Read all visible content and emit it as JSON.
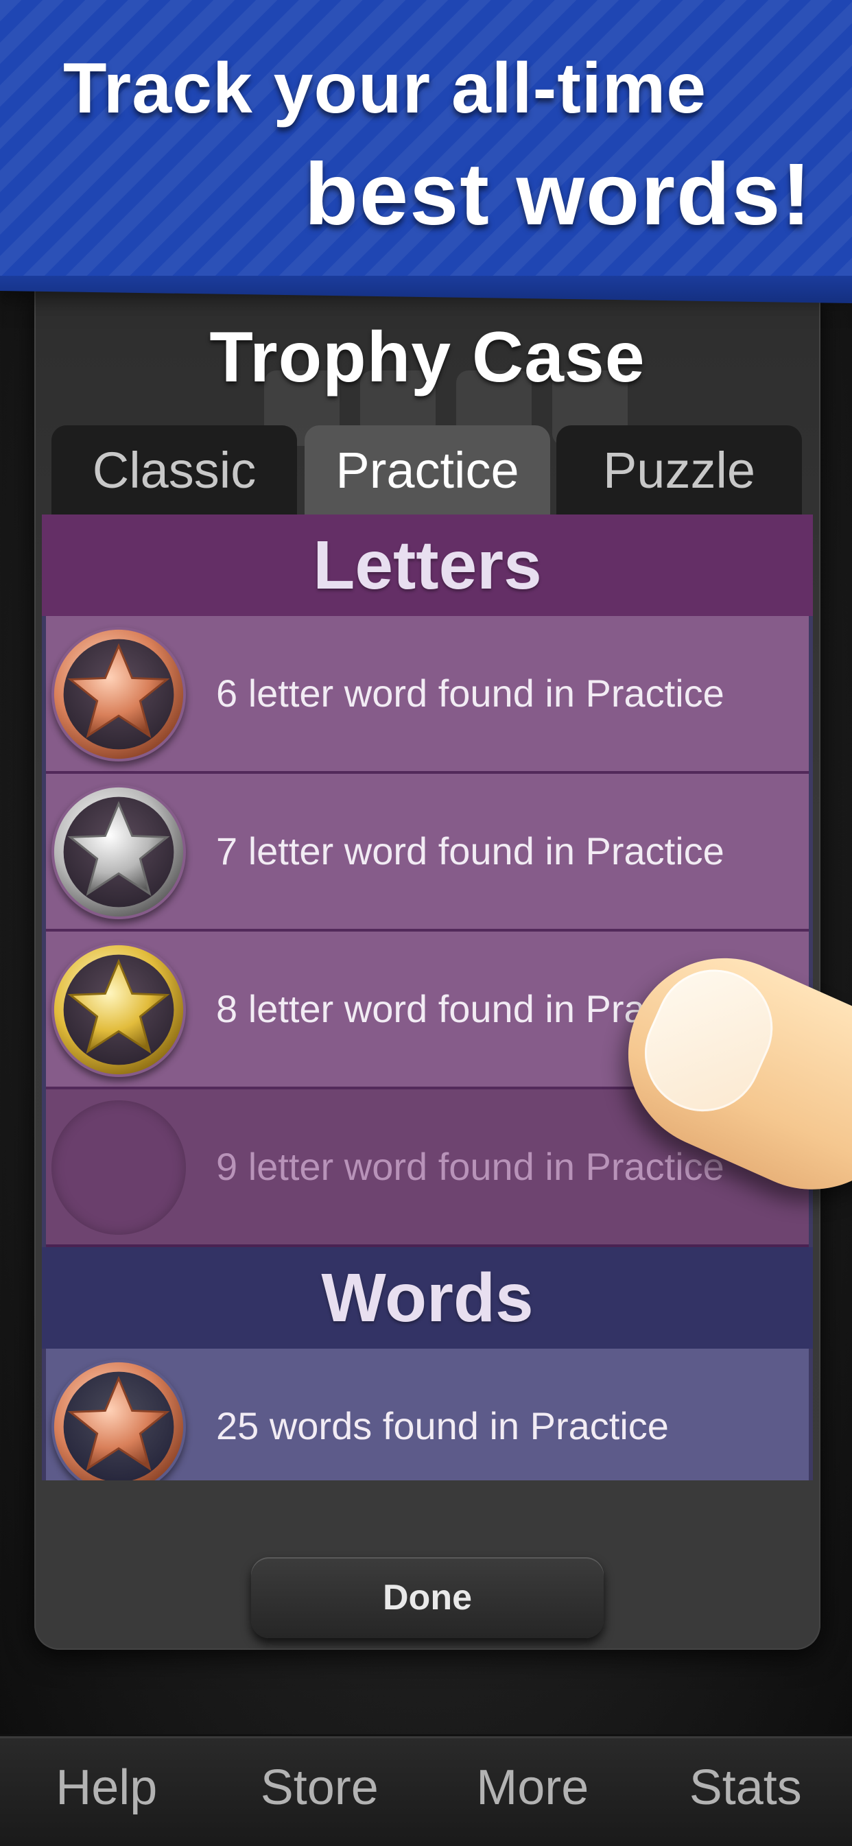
{
  "banner": {
    "line1": "Track your all-time",
    "line2": "best words!"
  },
  "panel": {
    "title": "Trophy Case",
    "tabs": [
      {
        "label": "Classic",
        "active": false
      },
      {
        "label": "Practice",
        "active": true
      },
      {
        "label": "Puzzle",
        "active": false
      }
    ],
    "sections": {
      "letters": {
        "title": "Letters",
        "rows": [
          {
            "text": "6 letter word found in Practice",
            "medal": "bronze-star-medal"
          },
          {
            "text": "7 letter word found in Practice",
            "medal": "silver-star-medal"
          },
          {
            "text": "8 letter word found in Practice",
            "medal": "gold-star-medal"
          },
          {
            "text": "9 letter word found in Practice",
            "medal": "locked-medal"
          }
        ]
      },
      "words": {
        "title": "Words",
        "rows": [
          {
            "text": "25 words found in Practice",
            "medal": "bronze-star-medal"
          }
        ]
      }
    },
    "done_label": "Done"
  },
  "bottom_nav": {
    "items": [
      "Help",
      "Store",
      "More",
      "Stats"
    ]
  },
  "colors": {
    "banner_blue": "#1f46b3",
    "letters_header": "#642f66",
    "letters_row": "#865c8a",
    "words_header": "#333365",
    "words_row": "#5d5b8a",
    "bronze": "#e8906a",
    "silver": "#c8c8c8",
    "gold": "#e8c84a"
  }
}
